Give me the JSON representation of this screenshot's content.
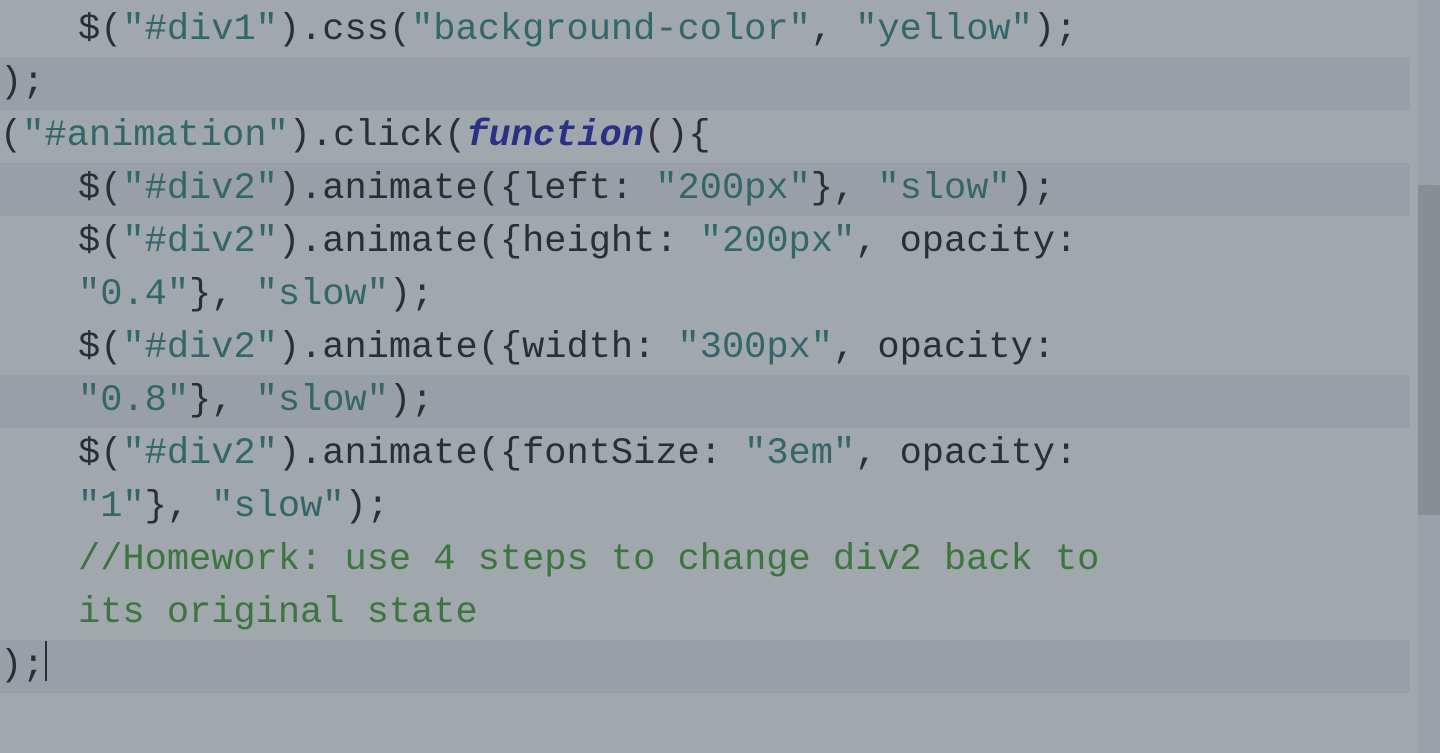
{
  "code": {
    "l1": {
      "pre": "$(",
      "s1": "\"#div1\"",
      "mid1": ").css(",
      "s2": "\"background-color\"",
      "mid2": ", ",
      "s3": "\"yellow\"",
      "post": ");"
    },
    "l2": ");",
    "l3": {
      "pre": "(",
      "s1": "\"#animation\"",
      "mid1": ").click(",
      "kw": "function",
      "post": "(){"
    },
    "l4": {
      "pre": "$(",
      "s1": "\"#div2\"",
      "mid1": ").animate({left: ",
      "s2": "\"200px\"",
      "mid2": "}, ",
      "s3": "\"slow\"",
      "post": ");"
    },
    "l5": {
      "pre": "$(",
      "s1": "\"#div2\"",
      "mid1": ").animate({height: ",
      "s2": "\"200px\"",
      "post": ", opacity: "
    },
    "l6": {
      "s1": "\"0.4\"",
      "mid1": "}, ",
      "s2": "\"slow\"",
      "post": ");"
    },
    "l7": {
      "pre": "$(",
      "s1": "\"#div2\"",
      "mid1": ").animate({width: ",
      "s2": "\"300px\"",
      "post": ", opacity: "
    },
    "l8": {
      "s1": "\"0.8\"",
      "mid1": "}, ",
      "s2": "\"slow\"",
      "post": ");"
    },
    "l9": {
      "pre": "$(",
      "s1": "\"#div2\"",
      "mid1": ").animate({fontSize: ",
      "s2": "\"3em\"",
      "post": ", opacity: "
    },
    "l10": {
      "s1": "\"1\"",
      "mid1": "}, ",
      "s2": "\"slow\"",
      "post": ");"
    },
    "l11": "//Homework: use 4 steps to change div2 back to ",
    "l12": "its original state",
    "l13": ");"
  }
}
